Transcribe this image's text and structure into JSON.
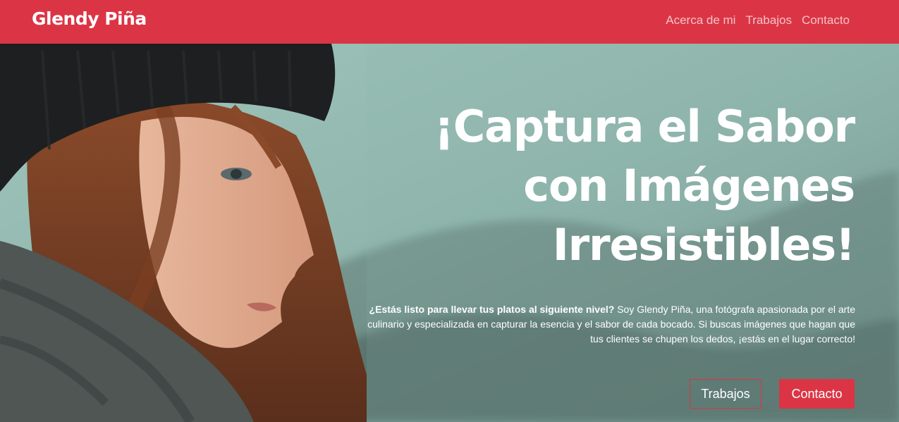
{
  "colors": {
    "accent": "#db3545",
    "sky": "#8fb5ac",
    "text": "#ffffff",
    "nav_link": "#f3c3c8"
  },
  "navbar": {
    "brand": "Glendy Piña",
    "links": [
      "Acerca de mi",
      "Trabajos",
      "Contacto"
    ]
  },
  "hero": {
    "title_lines": [
      "¡Captura el Sabor",
      "con Imágenes",
      "Irresistibles!"
    ],
    "intro_bold": "¿Estás listo para llevar tus platos al siguiente nivel?",
    "intro_rest": " Soy Glendy Piña, una fotógrafa apasionada por el arte culinario y especializada en capturar la esencia y el sabor de cada bocado. Si buscas imágenes que hagan que tus clientes se chupen los dedos, ¡estás en el lugar correcto!",
    "buttons": {
      "outline": "Trabajos",
      "solid": "Contacto"
    },
    "photo_icon": "portrait-photo"
  }
}
